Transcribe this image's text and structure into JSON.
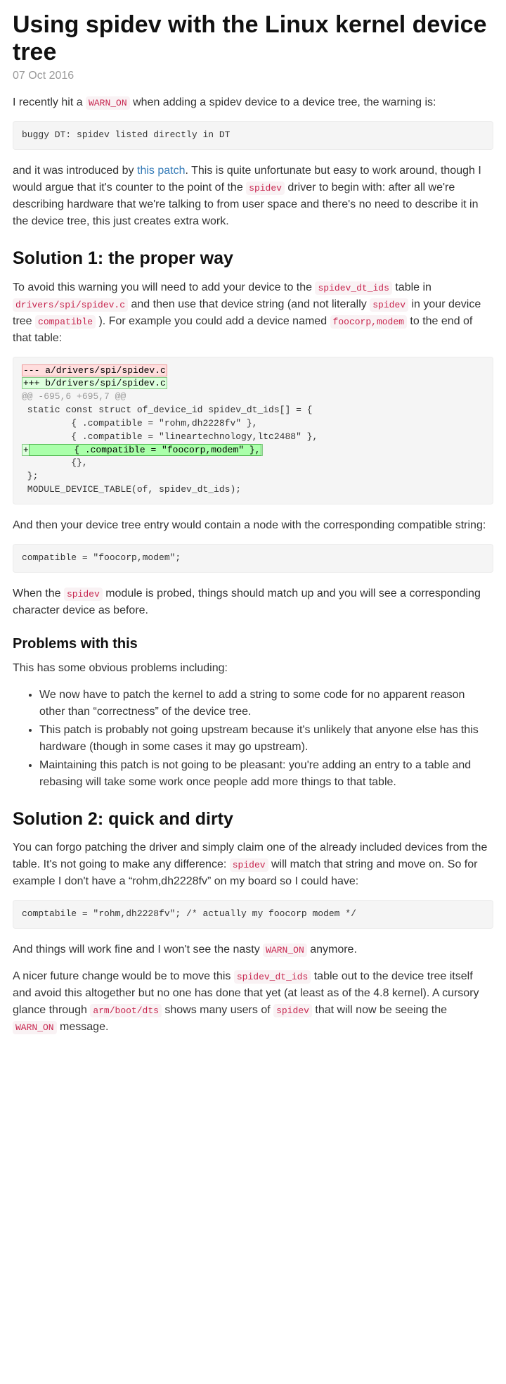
{
  "title": "Using spidev with the Linux kernel device tree",
  "date": "07 Oct 2016",
  "p1": {
    "a": "I recently hit a ",
    "code": "WARN_ON",
    "b": " when adding a spidev device to a device tree, the warning is:"
  },
  "code1": "buggy DT: spidev listed directly in DT",
  "p2": {
    "a": "and it was introduced by ",
    "link": "this patch",
    "b": ". This is quite unfortunate but easy to work around, though I would argue that it's counter to the point of the ",
    "code1": "spidev",
    "c": " driver to begin with: after all we're describing hardware that we're talking to from user space and there's no need to describe it in the device tree, this just creates extra work."
  },
  "h2_sol1": "Solution 1: the proper way",
  "p3": {
    "a": "To avoid this warning you will need to add your device to the ",
    "code1": "spidev_dt_ids",
    "b": " table in ",
    "code2": "drivers/spi/spidev.c",
    "c": " and then use that device string (and not literally ",
    "code3": "spidev",
    "d": " in your device tree ",
    "code4": "compatible",
    "e": " ). For example you could add a device named ",
    "code5": "foocorp,modem",
    "f": " to the end of that table:"
  },
  "diff": {
    "l1": "--- a/drivers/spi/spidev.c",
    "l2": "+++ b/drivers/spi/spidev.c",
    "l3": "@@ -695,6 +695,7 @@",
    "l4": " static const struct of_device_id spidev_dt_ids[] = {",
    "l5": "         { .compatible = \"rohm,dh2228fv\" },",
    "l6": "         { .compatible = \"lineartechnology,ltc2488\" },",
    "l7a": "+",
    "l7b": "        { .compatible = \"foocorp,modem\" },",
    "l8": "         {},",
    "l9": " };",
    "l10": " MODULE_DEVICE_TABLE(of, spidev_dt_ids);"
  },
  "p4": "And then your device tree entry would contain a node with the corresponding compatible string:",
  "code3": "compatible = \"foocorp,modem\";",
  "p5": {
    "a": "When the ",
    "code1": "spidev",
    "b": " module is probed, things should match up and you will see a corresponding character device as before."
  },
  "h3_problems": "Problems with this",
  "p6": "This has some obvious problems including:",
  "bullets": {
    "b1": "We now have to patch the kernel to add a string to some code for no apparent reason other than “correctness” of the device tree.",
    "b2": "This patch is probably not going upstream because it's unlikely that anyone else has this hardware (though in some cases it may go upstream).",
    "b3": "Maintaining this patch is not going to be pleasant: you're adding an entry to a table and rebasing will take some work once people add more things to that table."
  },
  "h2_sol2": "Solution 2: quick and dirty",
  "p7": {
    "a": "You can forgo patching the driver and simply claim one of the already included devices from the table. It's not going to make any difference: ",
    "code1": "spidev",
    "b": " will match that string and move on. So for example I don't have a “rohm,dh2228fv” on my board so I could have:"
  },
  "code4": "comptabile = \"rohm,dh2228fv\"; /* actually my foocorp modem */",
  "p8": {
    "a": "And things will work fine and I won't see the nasty ",
    "code1": "WARN_ON",
    "b": " anymore."
  },
  "p9": {
    "a": "A nicer future change would be to move this ",
    "code1": "spidev_dt_ids",
    "b": " table out to the device tree itself and avoid this altogether but no one has done that yet (at least as of the 4.8 kernel). A cursory glance through ",
    "code2": "arm/boot/dts",
    "c": " shows many users of ",
    "code3": "spidev",
    "d": " that will now be seeing the ",
    "code4": "WARN_ON",
    "e": " message."
  }
}
